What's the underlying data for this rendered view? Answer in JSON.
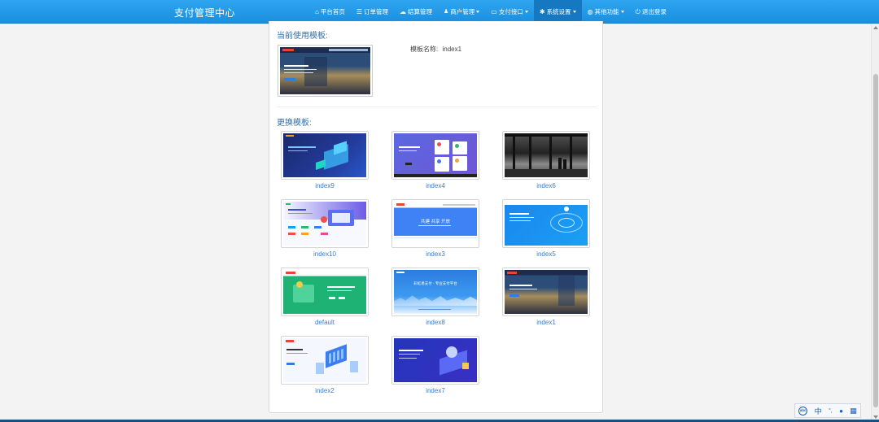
{
  "navbar": {
    "brand": "支付管理中心",
    "items": [
      {
        "label": "平台首页",
        "icon": "home-icon",
        "glyph": "⌂",
        "dropdown": false,
        "active": false
      },
      {
        "label": "订单管理",
        "icon": "list-icon",
        "glyph": "☰",
        "dropdown": false,
        "active": false
      },
      {
        "label": "结算管理",
        "icon": "cloud-icon",
        "glyph": "☁",
        "dropdown": false,
        "active": false
      },
      {
        "label": "商户管理",
        "icon": "user-icon",
        "glyph": "👤",
        "dropdown": true,
        "active": false
      },
      {
        "label": "支付接口",
        "icon": "card-icon",
        "glyph": "▭",
        "dropdown": true,
        "active": false
      },
      {
        "label": "系统设置",
        "icon": "gear-icon",
        "glyph": "✱",
        "dropdown": true,
        "active": true
      },
      {
        "label": "其他功能",
        "icon": "globe-icon",
        "glyph": "◍",
        "dropdown": true,
        "active": false
      },
      {
        "label": "退出登录",
        "icon": "power-icon",
        "glyph": "⏻",
        "dropdown": false,
        "active": false
      }
    ]
  },
  "current": {
    "title": "当前使用模板:",
    "name_label": "模板名称:",
    "name_value": "index1"
  },
  "change": {
    "title": "更换模板:",
    "templates": [
      {
        "name": "index9"
      },
      {
        "name": "index4"
      },
      {
        "name": "index6"
      },
      {
        "name": "index10"
      },
      {
        "name": "index3"
      },
      {
        "name": "index5"
      },
      {
        "name": "default"
      },
      {
        "name": "index8"
      },
      {
        "name": "index1"
      },
      {
        "name": "index2"
      },
      {
        "name": "index7"
      }
    ],
    "thumb_text": {
      "index3": "共建  共享  开放",
      "index8": "彩虹易支付 - 专业支付平台"
    }
  },
  "ime": {
    "logo": "abc",
    "lang": "中",
    "punct": "°,",
    "mic": "🎙",
    "grid": "▦"
  },
  "colors": {
    "nav_bg": "#1a8fdf",
    "nav_active": "#1778c2",
    "link": "#3a7bc8",
    "section_title": "#3a6ea5"
  }
}
